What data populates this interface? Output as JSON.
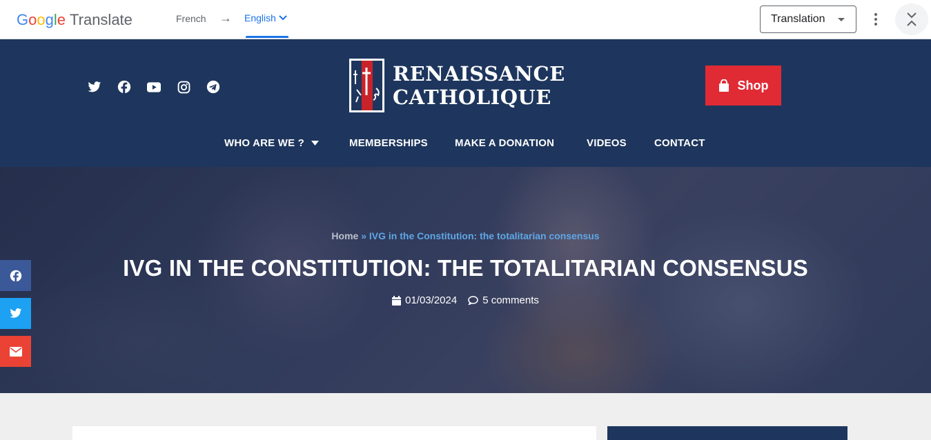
{
  "translate_bar": {
    "logo_google": "Google",
    "logo_translate": "Translate",
    "source_lang": "French",
    "target_lang": "English",
    "mode_select": "Translation"
  },
  "site": {
    "social_icons": [
      "twitter-icon",
      "facebook-icon",
      "youtube-icon",
      "instagram-icon",
      "telegram-icon"
    ],
    "logo_line1": "RENAISSANCE",
    "logo_line2": "CATHOLIQUE",
    "shop_label": "Shop",
    "nav": [
      {
        "label": "WHO ARE WE ?",
        "has_dropdown": true
      },
      {
        "label": "MEMBERSHIPS"
      },
      {
        "label": "MAKE A DONATION"
      },
      {
        "label": "VIDEOS"
      },
      {
        "label": "CONTACT"
      }
    ],
    "colors": {
      "header": "#1e365d",
      "shop": "#e02b35",
      "link": "#5fa7e6"
    }
  },
  "post": {
    "breadcrumb_home": "Home",
    "breadcrumb_sep": "»",
    "breadcrumb_current": "IVG in the Constitution: the totalitarian consensus",
    "title": "IVG IN THE CONSTITUTION: THE TOTALITARIAN CONSENSUS",
    "date": "01/03/2024",
    "comments": "5 comments"
  },
  "share": [
    "facebook-icon",
    "twitter-icon",
    "email-icon"
  ]
}
